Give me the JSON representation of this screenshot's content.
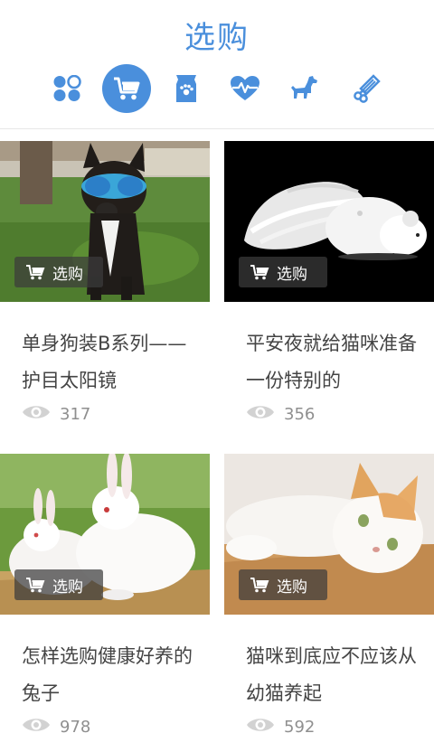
{
  "header": {
    "title": "选购",
    "tabs": [
      {
        "icon": "grid-dots-icon",
        "active": false
      },
      {
        "icon": "shopping-cart-icon",
        "active": true
      },
      {
        "icon": "pet-food-bag-icon",
        "active": false
      },
      {
        "icon": "heartbeat-icon",
        "active": false
      },
      {
        "icon": "dog-icon",
        "active": false
      },
      {
        "icon": "grooming-comb-icon",
        "active": false
      }
    ]
  },
  "accent_color": "#4a8fdc",
  "cards": [
    {
      "badge": "选购",
      "title": "单身狗装B系列——护目太阳镜",
      "views": "317",
      "image": "dog with goggles on grass"
    },
    {
      "badge": "选购",
      "title": "平安夜就给猫咪准备一份特别的",
      "views": "356",
      "image": "white mouse-shaped cat toy with feather on black"
    },
    {
      "badge": "选购",
      "title": "怎样选购健康好养的兔子",
      "views": "978",
      "image": "two white rabbits"
    },
    {
      "badge": "选购",
      "title": "猫咪到底应不应该从幼猫养起",
      "views": "592",
      "image": "white and orange cat lying on wood"
    }
  ]
}
